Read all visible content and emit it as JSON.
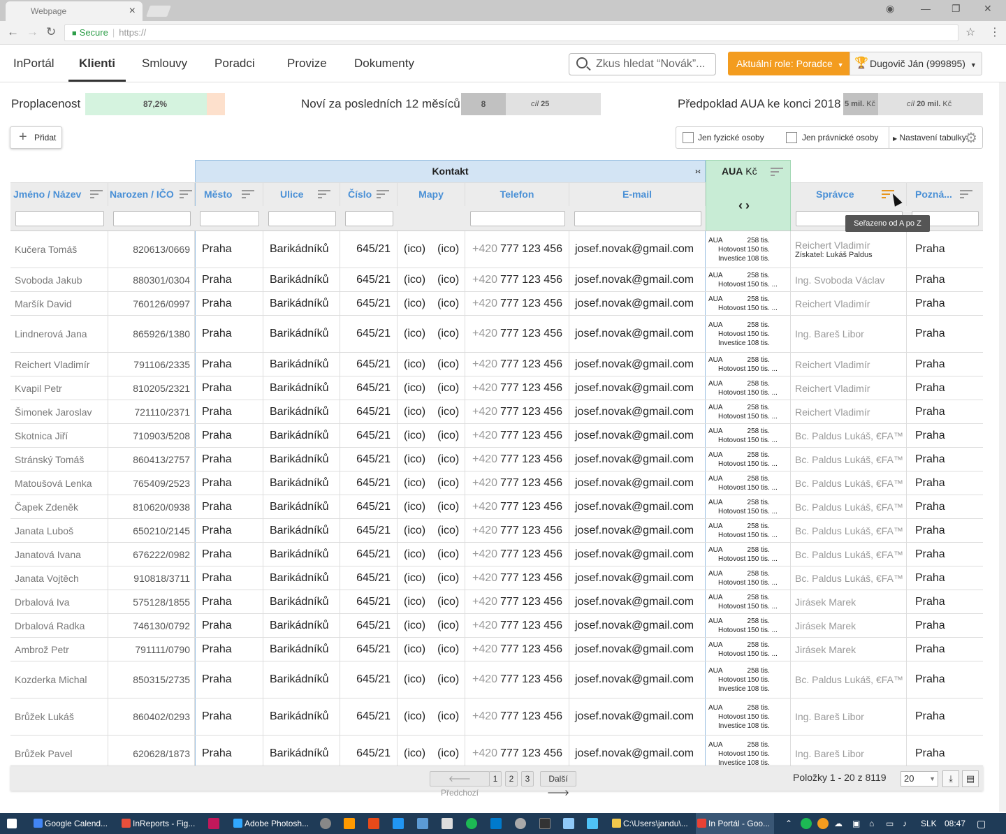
{
  "browser": {
    "tab_title": "Webpage",
    "secure_label": "Secure",
    "url": "https://"
  },
  "nav": {
    "items": [
      "InPortál",
      "Klienti",
      "Smlouvy",
      "Poradci",
      "Provize",
      "Dokumenty"
    ],
    "active": "Klienti",
    "search_placeholder": "Zkus hledat “Novák”...",
    "role_label": "Aktuální role: Poradce",
    "user_label": "Dugovič Ján (999895)"
  },
  "kpi": {
    "paid_label": "Proplacenost",
    "paid_value": "87,2%",
    "paid_fraction": 0.872,
    "new_label": "Noví za posledních 12 měsíců",
    "new_value": "8",
    "new_goal_prefix": "cíl",
    "new_goal": "25",
    "new_fraction": 0.32,
    "aua_label": "Předpoklad AUA ke konci 2018",
    "aua_value": "5 mil.",
    "aua_unit": "Kč",
    "aua_goal_prefix": "cíl",
    "aua_goal": "20 mil.",
    "aua_goal_unit": "Kč",
    "aua_fraction": 0.25
  },
  "toolbar": {
    "add_label": "Přidat",
    "filter_natural": "Jen fyzické osoby",
    "filter_legal": "Jen právnické osoby",
    "settings_label": "Nastavení tabulky"
  },
  "table": {
    "group_contact": "Kontakt",
    "group_aua": "AUA",
    "group_aua_unit": "Kč",
    "headers": {
      "name": "Jméno / Název",
      "birth": "Narozen / IČO",
      "city": "Město",
      "street": "Ulice",
      "number": "Číslo",
      "maps": "Mapy",
      "phone": "Telefon",
      "email": "E-mail",
      "manager": "Správce",
      "note": "Pozná..."
    },
    "tooltip": "Seřazeno od A po Z",
    "aua_labels": {
      "aua": "AUA",
      "cash": "Hotovost",
      "invest": "Investice"
    },
    "rows": [
      {
        "name": "Kučera Tomáš",
        "birth": "820613/0669",
        "city": "Praha",
        "street": "Barikádníků",
        "number": "645/21",
        "map1": "(ico)",
        "map2": "(ico)",
        "phone_prefix": "+420",
        "phone": "777 123 456",
        "email": "josef.novak@gmail.com",
        "aua": "258 tis.",
        "cash": "150 tis.",
        "invest": "108 tis.",
        "manager": "Reichert Vladimír",
        "acquirer": "Získatel: Lukáš Paldus",
        "note": "Praha"
      },
      {
        "name": "Svoboda Jakub",
        "birth": "880301/0304",
        "city": "Praha",
        "street": "Barikádníků",
        "number": "645/21",
        "map1": "(ico)",
        "map2": "(ico)",
        "phone_prefix": "+420",
        "phone": "777 123 456",
        "email": "josef.novak@gmail.com",
        "aua": "258 tis.",
        "cash": "150 tis. ...",
        "manager": "Ing. Svoboda Václav",
        "note": "Praha"
      },
      {
        "name": "Maršík David",
        "birth": "760126/0997",
        "city": "Praha",
        "street": "Barikádníků",
        "number": "645/21",
        "map1": "(ico)",
        "map2": "(ico)",
        "phone_prefix": "+420",
        "phone": "777 123 456",
        "email": "josef.novak@gmail.com",
        "aua": "258 tis.",
        "cash": "150 tis. ...",
        "manager": "Reichert Vladimír",
        "note": "Praha"
      },
      {
        "name": "Lindnerová Jana",
        "birth": "865926/1380",
        "city": "Praha",
        "street": "Barikádníků",
        "number": "645/21",
        "map1": "(ico)",
        "map2": "(ico)",
        "phone_prefix": "+420",
        "phone": "777 123 456",
        "email": "josef.novak@gmail.com",
        "aua": "258 tis.",
        "cash": "150 tis.",
        "invest": "108 tis.",
        "manager": "Ing. Bareš Libor",
        "note": "Praha"
      },
      {
        "name": "Reichert Vladimír",
        "birth": "791106/2335",
        "city": "Praha",
        "street": "Barikádníků",
        "number": "645/21",
        "map1": "(ico)",
        "map2": "(ico)",
        "phone_prefix": "+420",
        "phone": "777 123 456",
        "email": "josef.novak@gmail.com",
        "aua": "258 tis.",
        "cash": "150 tis. ...",
        "manager": "Reichert Vladimír",
        "note": "Praha"
      },
      {
        "name": "Kvapil Petr",
        "birth": "810205/2321",
        "city": "Praha",
        "street": "Barikádníků",
        "number": "645/21",
        "map1": "(ico)",
        "map2": "(ico)",
        "phone_prefix": "+420",
        "phone": "777 123 456",
        "email": "josef.novak@gmail.com",
        "aua": "258 tis.",
        "cash": "150 tis. ...",
        "manager": "Reichert Vladimír",
        "note": "Praha"
      },
      {
        "name": "Šimonek Jaroslav",
        "birth": "721110/2371",
        "city": "Praha",
        "street": "Barikádníků",
        "number": "645/21",
        "map1": "(ico)",
        "map2": "(ico)",
        "phone_prefix": "+420",
        "phone": "777 123 456",
        "email": "josef.novak@gmail.com",
        "aua": "258 tis.",
        "cash": "150 tis. ...",
        "manager": "Reichert Vladimír",
        "note": "Praha"
      },
      {
        "name": "Skotnica Jiří",
        "birth": "710903/5208",
        "city": "Praha",
        "street": "Barikádníků",
        "number": "645/21",
        "map1": "(ico)",
        "map2": "(ico)",
        "phone_prefix": "+420",
        "phone": "777 123 456",
        "email": "josef.novak@gmail.com",
        "aua": "258 tis.",
        "cash": "150 tis. ...",
        "manager": "Bc. Paldus Lukáš, €FA™",
        "note": "Praha"
      },
      {
        "name": "Stránský Tomáš",
        "birth": "860413/2757",
        "city": "Praha",
        "street": "Barikádníků",
        "number": "645/21",
        "map1": "(ico)",
        "map2": "(ico)",
        "phone_prefix": "+420",
        "phone": "777 123 456",
        "email": "josef.novak@gmail.com",
        "aua": "258 tis.",
        "cash": "150 tis. ...",
        "manager": "Bc. Paldus Lukáš, €FA™",
        "note": "Praha"
      },
      {
        "name": "Matoušová Lenka",
        "birth": "765409/2523",
        "city": "Praha",
        "street": "Barikádníků",
        "number": "645/21",
        "map1": "(ico)",
        "map2": "(ico)",
        "phone_prefix": "+420",
        "phone": "777 123 456",
        "email": "josef.novak@gmail.com",
        "aua": "258 tis.",
        "cash": "150 tis. ...",
        "manager": "Bc. Paldus Lukáš, €FA™",
        "note": "Praha"
      },
      {
        "name": "Čapek Zdeněk",
        "birth": "810620/0938",
        "city": "Praha",
        "street": "Barikádníků",
        "number": "645/21",
        "map1": "(ico)",
        "map2": "(ico)",
        "phone_prefix": "+420",
        "phone": "777 123 456",
        "email": "josef.novak@gmail.com",
        "aua": "258 tis.",
        "cash": "150 tis. ...",
        "manager": "Bc. Paldus Lukáš, €FA™",
        "note": "Praha"
      },
      {
        "name": "Janata Luboš",
        "birth": "650210/2145",
        "city": "Praha",
        "street": "Barikádníků",
        "number": "645/21",
        "map1": "(ico)",
        "map2": "(ico)",
        "phone_prefix": "+420",
        "phone": "777 123 456",
        "email": "josef.novak@gmail.com",
        "aua": "258 tis.",
        "cash": "150 tis. ...",
        "manager": "Bc. Paldus Lukáš, €FA™",
        "note": "Praha"
      },
      {
        "name": "Janatová Ivana",
        "birth": "676222/0982",
        "city": "Praha",
        "street": "Barikádníků",
        "number": "645/21",
        "map1": "(ico)",
        "map2": "(ico)",
        "phone_prefix": "+420",
        "phone": "777 123 456",
        "email": "josef.novak@gmail.com",
        "aua": "258 tis.",
        "cash": "150 tis. ...",
        "manager": "Bc. Paldus Lukáš, €FA™",
        "note": "Praha"
      },
      {
        "name": "Janata Vojtěch",
        "birth": "910818/3711",
        "city": "Praha",
        "street": "Barikádníků",
        "number": "645/21",
        "map1": "(ico)",
        "map2": "(ico)",
        "phone_prefix": "+420",
        "phone": "777 123 456",
        "email": "josef.novak@gmail.com",
        "aua": "258 tis.",
        "cash": "150 tis. ...",
        "manager": "Bc. Paldus Lukáš, €FA™",
        "note": "Praha"
      },
      {
        "name": "Drbalová Iva",
        "birth": "575128/1855",
        "city": "Praha",
        "street": "Barikádníků",
        "number": "645/21",
        "map1": "(ico)",
        "map2": "(ico)",
        "phone_prefix": "+420",
        "phone": "777 123 456",
        "email": "josef.novak@gmail.com",
        "aua": "258 tis.",
        "cash": "150 tis. ...",
        "manager": "Jirásek Marek",
        "note": "Praha"
      },
      {
        "name": "Drbalová Radka",
        "birth": "746130/0792",
        "city": "Praha",
        "street": "Barikádníků",
        "number": "645/21",
        "map1": "(ico)",
        "map2": "(ico)",
        "phone_prefix": "+420",
        "phone": "777 123 456",
        "email": "josef.novak@gmail.com",
        "aua": "258 tis.",
        "cash": "150 tis. ...",
        "manager": "Jirásek Marek",
        "note": "Praha"
      },
      {
        "name": "Ambrož Petr",
        "birth": "791111/0790",
        "city": "Praha",
        "street": "Barikádníků",
        "number": "645/21",
        "map1": "(ico)",
        "map2": "(ico)",
        "phone_prefix": "+420",
        "phone": "777 123 456",
        "email": "josef.novak@gmail.com",
        "aua": "258 tis.",
        "cash": "150 tis. ...",
        "manager": "Jirásek Marek",
        "note": "Praha"
      },
      {
        "name": "Kozderka Michal",
        "birth": "850315/2735",
        "city": "Praha",
        "street": "Barikádníků",
        "number": "645/21",
        "map1": "(ico)",
        "map2": "(ico)",
        "phone_prefix": "+420",
        "phone": "777 123 456",
        "email": "josef.novak@gmail.com",
        "aua": "258 tis.",
        "cash": "150 tis.",
        "invest": "108 tis.",
        "manager": "Bc. Paldus Lukáš, €FA™",
        "note": "Praha"
      },
      {
        "name": "Brůžek Lukáš",
        "birth": "860402/0293",
        "city": "Praha",
        "street": "Barikádníků",
        "number": "645/21",
        "map1": "(ico)",
        "map2": "(ico)",
        "phone_prefix": "+420",
        "phone": "777 123 456",
        "email": "josef.novak@gmail.com",
        "aua": "258 tis.",
        "cash": "150 tis.",
        "invest": "108 tis.",
        "manager": "Ing. Bareš Libor",
        "note": "Praha"
      },
      {
        "name": "Brůžek Pavel",
        "birth": "620628/1873",
        "city": "Praha",
        "street": "Barikádníků",
        "number": "645/21",
        "map1": "(ico)",
        "map2": "(ico)",
        "phone_prefix": "+420",
        "phone": "777 123 456",
        "email": "josef.novak@gmail.com",
        "aua": "258 tis.",
        "cash": "150 tis.",
        "invest": "108 tis.",
        "manager": "Ing. Bareš Libor",
        "note": "Praha"
      }
    ]
  },
  "pager": {
    "prev_label": "Předchozí",
    "pages": [
      "1",
      "2",
      "3"
    ],
    "next_label": "Další",
    "info": "Položky 1 - 20 z 8119",
    "page_size": "20"
  },
  "taskbar": {
    "items": [
      "Google Calend...",
      "InReports - Fig...",
      "Adobe Photosh...",
      "C:\\Users\\jandu\\...",
      "In Portál - Goo..."
    ],
    "lang": "SLK",
    "time": "08:47"
  }
}
